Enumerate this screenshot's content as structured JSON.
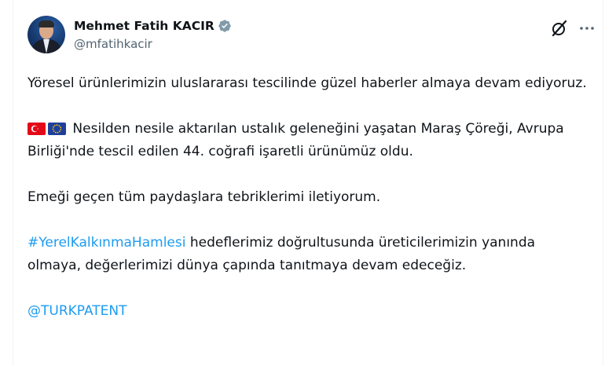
{
  "author": {
    "display_name": "Mehmet Fatih KACIR",
    "handle": "@mfatihkacir",
    "verified": true
  },
  "icons": {
    "avatar": "profile-photo",
    "verified": "verified-badge-icon",
    "grok": "grok-icon",
    "more": "more-dots-icon",
    "flag_tr": "turkey-flag-icon",
    "flag_eu": "eu-flag-icon"
  },
  "colors": {
    "text": "#0f1419",
    "secondary": "#536471",
    "link": "#1d9bf0"
  },
  "tweet": {
    "p1": "Yöresel ürünlerimizin uluslararası tescilinde güzel haberler almaya devam ediyoruz.",
    "p2": "Nesilden nesile aktarılan ustalık geleneğini yaşatan Maraş Çöreği, Avrupa Birliği'nde tescil edilen 44. coğrafi işaretli ürünümüz oldu.",
    "p3": "Emeği geçen tüm paydaşlara tebriklerimi iletiyorum.",
    "p4_hashtag": "#YerelKalkınmaHamlesi",
    "p4_text": " hedeflerimiz doğrultusunda üreticilerimizin yanında olmaya, değerlerimizi dünya çapında tanıtmaya devam edeceğiz.",
    "mention": "@TURKPATENT"
  }
}
